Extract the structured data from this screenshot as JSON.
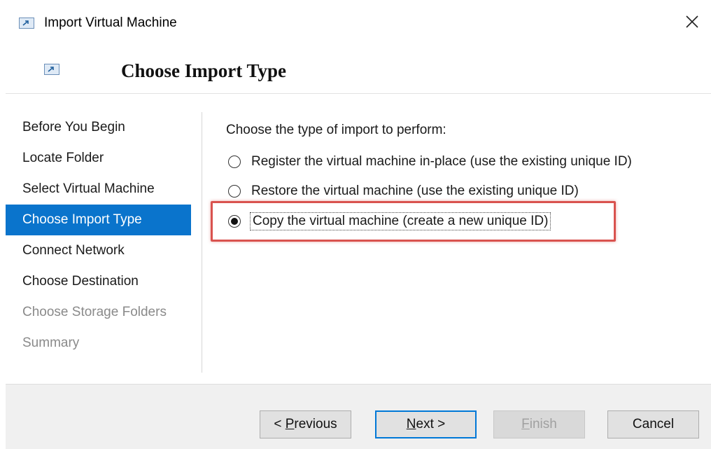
{
  "window": {
    "title": "Import Virtual Machine",
    "close_icon": "close-icon",
    "app_icon": "vm-import-icon"
  },
  "page": {
    "heading": "Choose Import Type"
  },
  "nav": {
    "items": [
      {
        "label": "Before You Begin",
        "state": "normal"
      },
      {
        "label": "Locate Folder",
        "state": "normal"
      },
      {
        "label": "Select Virtual Machine",
        "state": "normal"
      },
      {
        "label": "Choose Import Type",
        "state": "active"
      },
      {
        "label": "Connect Network",
        "state": "normal"
      },
      {
        "label": "Choose Destination",
        "state": "normal"
      },
      {
        "label": "Choose Storage Folders",
        "state": "disabled"
      },
      {
        "label": "Summary",
        "state": "disabled"
      }
    ]
  },
  "content": {
    "prompt": "Choose the type of import to perform:",
    "options": [
      {
        "label": "Register the virtual machine in-place (use the existing unique ID)",
        "checked": false
      },
      {
        "label": "Restore the virtual machine (use the existing unique ID)",
        "checked": false
      },
      {
        "label": "Copy the virtual machine (create a new unique ID)",
        "checked": true
      }
    ]
  },
  "buttons": {
    "previous": {
      "pre": "< ",
      "accel": "P",
      "rest": "revious"
    },
    "next": {
      "accel": "N",
      "rest": "ext >"
    },
    "finish": {
      "accel": "F",
      "rest": "inish"
    },
    "cancel": "Cancel"
  },
  "colors": {
    "accent": "#0a74cc",
    "highlight_box": "#d9534f",
    "footer_bg": "#f0f0f0"
  }
}
